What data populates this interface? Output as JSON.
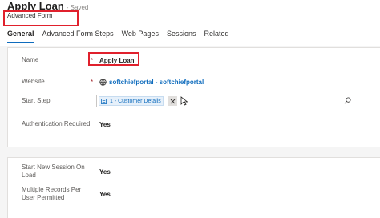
{
  "header": {
    "title": "Apply Loan",
    "save_status": "- Saved",
    "entity_name": "Advanced Form"
  },
  "tabs": [
    {
      "label": "General",
      "active": true
    },
    {
      "label": "Advanced Form Steps",
      "active": false
    },
    {
      "label": "Web Pages",
      "active": false
    },
    {
      "label": "Sessions",
      "active": false
    },
    {
      "label": "Related",
      "active": false
    }
  ],
  "section1": {
    "name": {
      "label": "Name",
      "required": "*",
      "value": "Apply Loan"
    },
    "website": {
      "label": "Website",
      "required": "*",
      "value": "softchiefportal - softchiefportal",
      "icon": "globe-icon"
    },
    "start_step": {
      "label": "Start Step",
      "value": "1 - Customer Details",
      "icon": "form-step-icon"
    },
    "authentication": {
      "label": "Authentication Required",
      "value": "Yes"
    }
  },
  "section2": {
    "start_new_session": {
      "label": "Start New Session On Load",
      "value": "Yes"
    },
    "multiple_records": {
      "label": "Multiple Records Per User Permitted",
      "value": "Yes"
    }
  },
  "colors": {
    "accent": "#0f6cbd",
    "highlight": "#e0202c",
    "required": "#a4262c"
  }
}
